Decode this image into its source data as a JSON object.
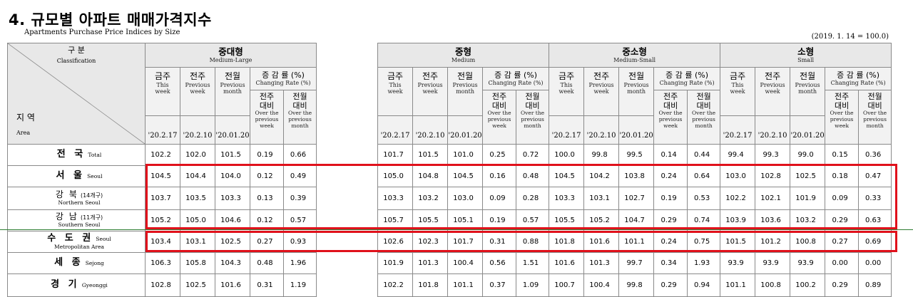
{
  "title": "4. 규모별 아파트 매매가격지수",
  "subtitle": "Apartments Purchase Price Indices by Size",
  "base_note": "(2019. 1. 14 = 100.0)",
  "header": {
    "classification_ko": "구 분",
    "classification_en": "Classification",
    "region_ko": "지 역",
    "region_en": "Area",
    "col_this_ko": "금주",
    "col_this_en_1": "This",
    "col_this_en_2": "week",
    "col_prev_ko": "전주",
    "col_prev_en_1": "Previous",
    "col_prev_en_2": "week",
    "col_month_ko": "전월",
    "col_month_en_1": "Previous",
    "col_month_en_2": "month",
    "rate_ko": "증 감 률 (%)",
    "rate_en": "Changing Rate (%)",
    "rate_week_ko_1": "전주",
    "rate_week_ko_2": "대비",
    "rate_week_en": "Over the previous week",
    "rate_month_ko_1": "전월",
    "rate_month_ko_2": "대비",
    "rate_month_en": "Over the previous month",
    "date_this": "'20.2.17",
    "date_prev": "'20.2.10",
    "date_month": "'20.01.20"
  },
  "groups": [
    {
      "ko": "중대형",
      "en": "Medium-Large"
    },
    {
      "ko": "중형",
      "en": "Medium"
    },
    {
      "ko": "중소형",
      "en": "Medium-Small"
    },
    {
      "ko": "소형",
      "en": "Small"
    }
  ],
  "rows": [
    {
      "ko": "전 국",
      "en": "Total",
      "g1": [
        "102.2",
        "102.0",
        "101.5",
        "0.19",
        "0.66"
      ],
      "g2": [
        "101.7",
        "101.5",
        "101.0",
        "0.25",
        "0.72"
      ],
      "g3": [
        "100.0",
        "99.8",
        "99.5",
        "0.14",
        "0.44"
      ],
      "g4": [
        "99.4",
        "99.3",
        "99.0",
        "0.15",
        "0.36"
      ]
    },
    {
      "ko": "서 울",
      "en": "Seoul",
      "g1": [
        "104.5",
        "104.4",
        "104.0",
        "0.12",
        "0.49"
      ],
      "g2": [
        "105.0",
        "104.8",
        "104.5",
        "0.16",
        "0.48"
      ],
      "g3": [
        "104.5",
        "104.2",
        "103.8",
        "0.24",
        "0.64"
      ],
      "g4": [
        "103.0",
        "102.8",
        "102.5",
        "0.18",
        "0.47"
      ]
    },
    {
      "ko": "강 북",
      "paren": "(14개구)",
      "en": "Northern Seoul",
      "g1": [
        "103.7",
        "103.5",
        "103.3",
        "0.13",
        "0.39"
      ],
      "g2": [
        "103.3",
        "103.2",
        "103.0",
        "0.09",
        "0.28"
      ],
      "g3": [
        "103.3",
        "103.1",
        "102.7",
        "0.19",
        "0.53"
      ],
      "g4": [
        "102.2",
        "102.1",
        "101.9",
        "0.09",
        "0.33"
      ]
    },
    {
      "ko": "강 남",
      "paren": "(11개구)",
      "en": "Southern Seoul",
      "g1": [
        "105.2",
        "105.0",
        "104.6",
        "0.12",
        "0.57"
      ],
      "g2": [
        "105.7",
        "105.5",
        "105.1",
        "0.19",
        "0.57"
      ],
      "g3": [
        "105.5",
        "105.2",
        "104.7",
        "0.29",
        "0.74"
      ],
      "g4": [
        "103.9",
        "103.6",
        "103.2",
        "0.29",
        "0.63"
      ]
    },
    {
      "ko": "수 도 권",
      "en": "Seoul",
      "en2": "Metropolitan Area",
      "g1": [
        "103.4",
        "103.1",
        "102.5",
        "0.27",
        "0.93"
      ],
      "g2": [
        "102.6",
        "102.3",
        "101.7",
        "0.31",
        "0.88"
      ],
      "g3": [
        "101.8",
        "101.6",
        "101.1",
        "0.24",
        "0.75"
      ],
      "g4": [
        "101.5",
        "101.2",
        "100.8",
        "0.27",
        "0.69"
      ]
    },
    {
      "ko": "세 종",
      "en": "Sejong",
      "g1": [
        "106.3",
        "105.8",
        "104.3",
        "0.48",
        "1.96"
      ],
      "g2": [
        "101.9",
        "101.3",
        "100.4",
        "0.56",
        "1.51"
      ],
      "g3": [
        "101.6",
        "101.3",
        "99.7",
        "0.34",
        "1.93"
      ],
      "g4": [
        "93.9",
        "93.9",
        "93.9",
        "0.00",
        "0.00"
      ]
    },
    {
      "ko": "경 기",
      "en": "Gyeonggi",
      "g1": [
        "102.8",
        "102.5",
        "101.6",
        "0.31",
        "1.19"
      ],
      "g2": [
        "102.2",
        "101.8",
        "101.1",
        "0.37",
        "1.09"
      ],
      "g3": [
        "100.7",
        "100.4",
        "99.8",
        "0.29",
        "0.94"
      ],
      "g4": [
        "101.1",
        "100.8",
        "100.2",
        "0.29",
        "0.89"
      ]
    }
  ],
  "colors": {
    "highlight": "#e0111b",
    "header_bg": "#e8e8e8",
    "divider": "#2e7d32"
  }
}
